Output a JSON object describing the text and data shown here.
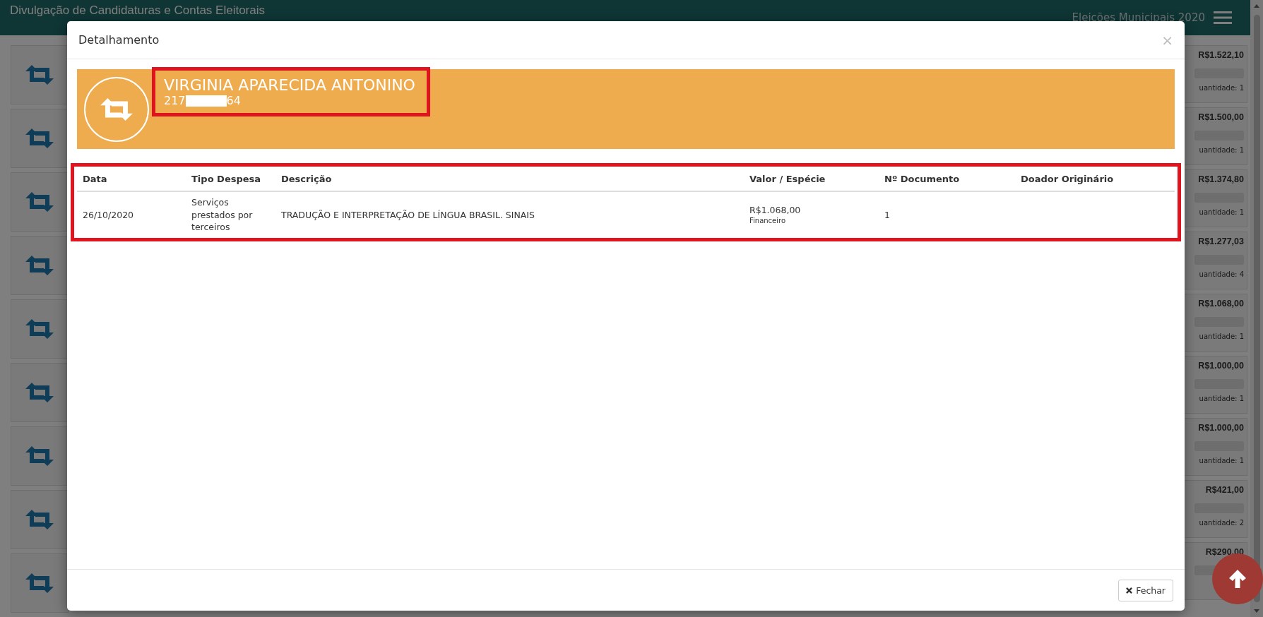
{
  "header": {
    "title": "Divulgação de Candidaturas e Contas Eleitorais",
    "election": "Eleições Municipais 2020"
  },
  "background_rows": [
    {
      "amount": "R$1.522,10",
      "quantity": "uantidade: 1"
    },
    {
      "amount": "R$1.500,00",
      "quantity": "uantidade: 1"
    },
    {
      "amount": "R$1.374,80",
      "quantity": "uantidade: 1"
    },
    {
      "amount": "R$1.277,03",
      "quantity": "uantidade: 4"
    },
    {
      "amount": "R$1.068,00",
      "quantity": "uantidade: 1"
    },
    {
      "amount": "R$1.000,00",
      "quantity": "uantidade: 1"
    },
    {
      "amount": "R$1.000,00",
      "quantity": "uantidade: 1"
    },
    {
      "amount": "R$421,00",
      "quantity": "uantidade: 2"
    },
    {
      "amount": "R$290,00"
    }
  ],
  "modal": {
    "title": "Detalhamento",
    "close": "×",
    "candidate": {
      "name": "VIRGINIA APARECIDA ANTONINO",
      "number_start": "217",
      "number_end": "64"
    },
    "table": {
      "columns": [
        "Data",
        "Tipo Despesa",
        "Descrição",
        "Valor / Espécie",
        "Nº Documento",
        "Doador Originário"
      ],
      "rows": [
        {
          "date": "26/10/2020",
          "type": "Serviços prestados por terceiros",
          "description": "TRADUÇÃO E INTERPRETAÇÃO DE LÍNGUA BRASIL. SINAIS",
          "value": "R$1.068,00",
          "species": "Financeiro",
          "document": "1"
        }
      ]
    },
    "close_button": "Fechar"
  }
}
